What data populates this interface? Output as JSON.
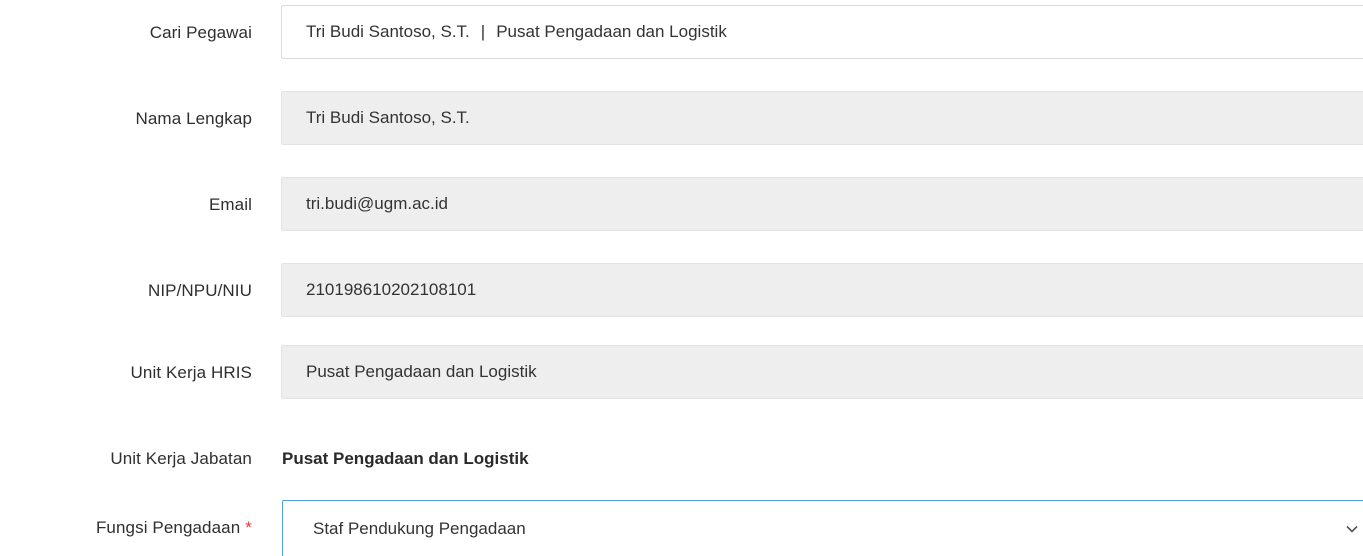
{
  "form": {
    "cari_pegawai": {
      "label": "Cari Pegawai",
      "name": "Tri Budi Santoso, S.T.",
      "separator": "|",
      "unit": "Pusat Pengadaan dan Logistik"
    },
    "nama_lengkap": {
      "label": "Nama Lengkap",
      "value": "Tri Budi Santoso, S.T."
    },
    "email": {
      "label": "Email",
      "value": "tri.budi@ugm.ac.id"
    },
    "nip": {
      "label": "NIP/NPU/NIU",
      "value": "210198610202108101"
    },
    "unit_kerja_hris": {
      "label": "Unit Kerja HRIS",
      "value": "Pusat Pengadaan dan Logistik"
    },
    "unit_kerja_jabatan": {
      "label": "Unit Kerja Jabatan",
      "value": "Pusat Pengadaan dan Logistik"
    },
    "fungsi_pengadaan": {
      "label": "Fungsi Pengadaan",
      "required_mark": "*",
      "selected": "Staf Pendukung Pengadaan"
    }
  },
  "colors": {
    "required": "#e53935",
    "focus_border": "#4aa3df",
    "readonly_bg": "#eeeeee"
  },
  "icons": {
    "select_arrow": "chevron-down-icon"
  }
}
